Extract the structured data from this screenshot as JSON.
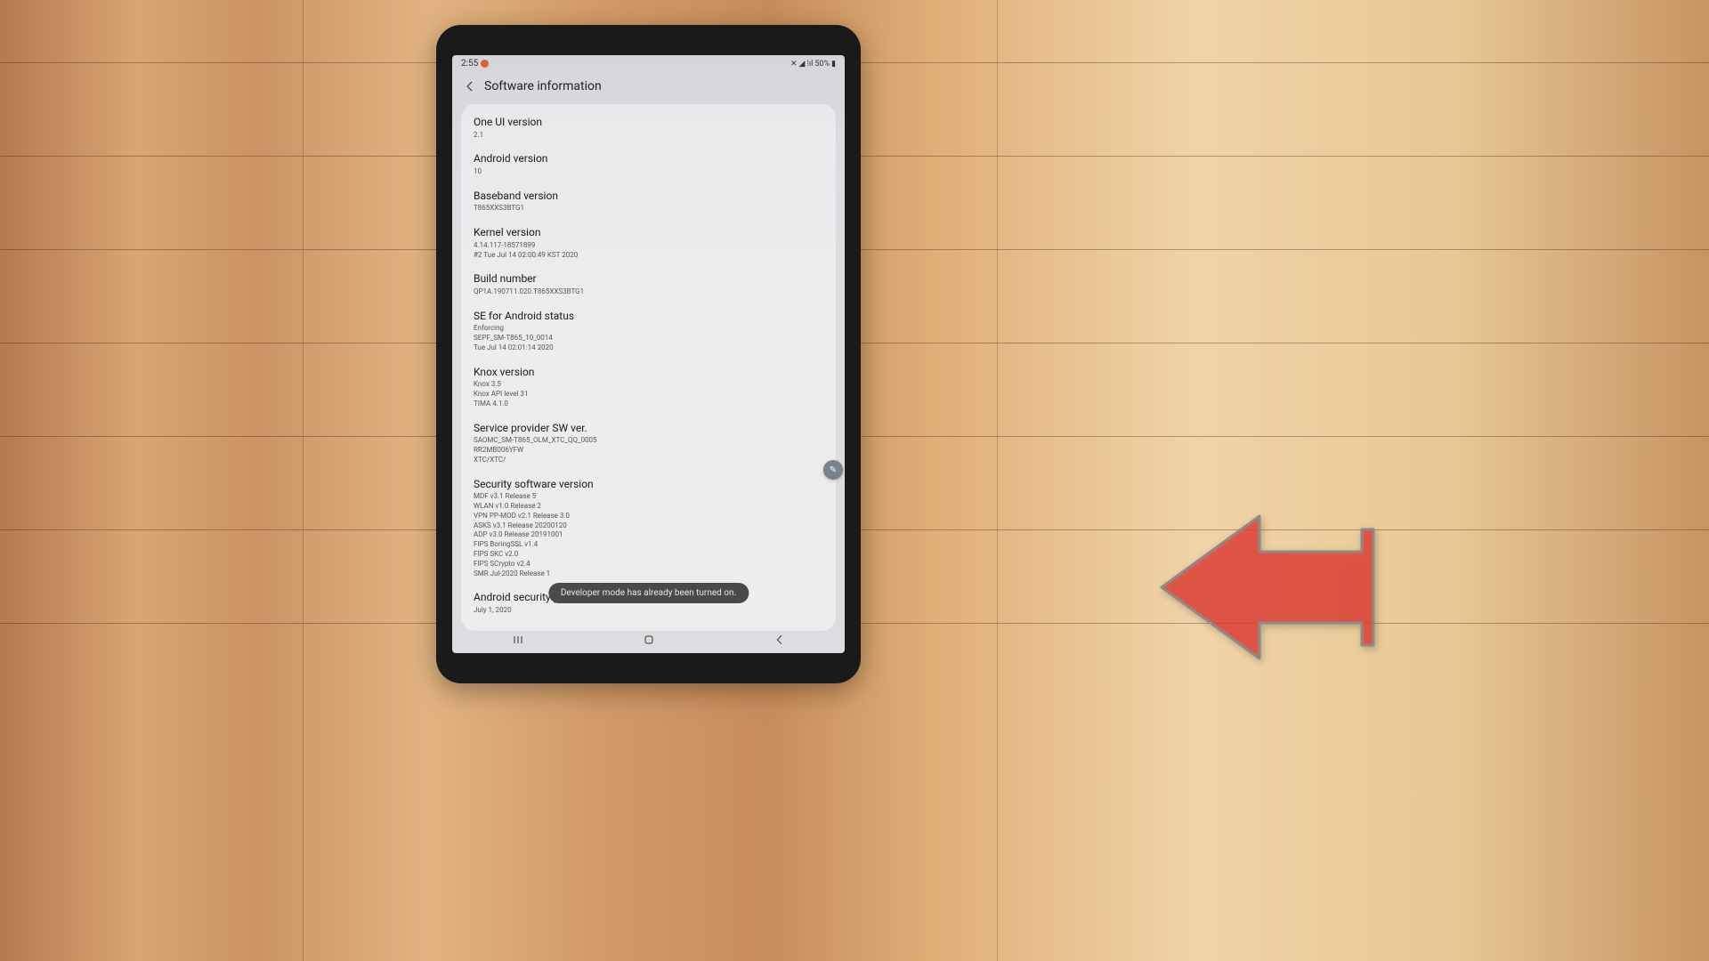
{
  "statusbar": {
    "time": "2:55",
    "battery": "50%"
  },
  "header": {
    "title": "Software information"
  },
  "items": [
    {
      "title": "One UI version",
      "sub": "2.1"
    },
    {
      "title": "Android version",
      "sub": "10"
    },
    {
      "title": "Baseband version",
      "sub": "T865XXS3BTG1"
    },
    {
      "title": "Kernel version",
      "sub": "4.14.117-18571899\n#2 Tue Jul 14 02:00:49 KST 2020"
    },
    {
      "title": "Build number",
      "sub": "QP1A.190711.020.T865XXS3BTG1"
    },
    {
      "title": "SE for Android status",
      "sub": "Enforcing\nSEPF_SM-T865_10_0014\nTue Jul 14 02:01:14 2020"
    },
    {
      "title": "Knox version",
      "sub": "Knox 3.5\nKnox API level 31\nTIMA 4.1.0"
    },
    {
      "title": "Service provider SW ver.",
      "sub": "SAOMC_SM-T865_OLM_XTC_QQ_0005\nRR2MB006YFW\nXTC/XTC/"
    },
    {
      "title": "Security software version",
      "sub": "MDF v3.1 Release 5\nWLAN v1.0 Release 2\nVPN PP-MOD v2.1 Release 3.0\nASKS v3.1 Release 20200120\nADP v3.0 Release 20191001\nFIPS BoringSSL v1.4\nFIPS SKC v2.0\nFIPS SCrypto v2.4\nSMR Jul-2020 Release 1"
    },
    {
      "title": "Android security patch level",
      "sub": "July 1, 2020"
    }
  ],
  "toast": {
    "message": "Developer mode has already been turned on."
  },
  "fab": {
    "icon": "✎"
  }
}
